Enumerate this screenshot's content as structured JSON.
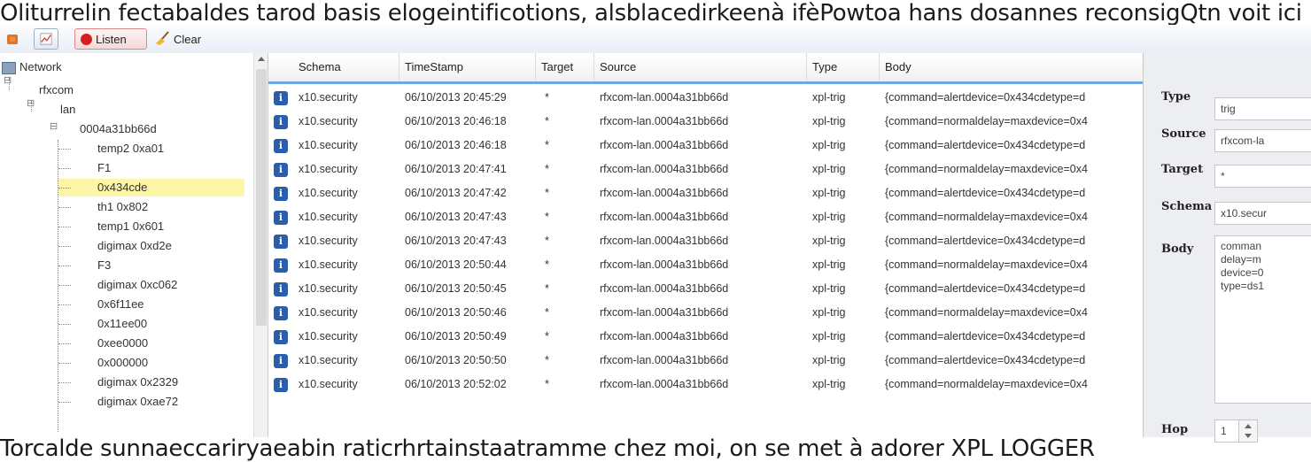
{
  "overlay": {
    "top_text": "Oliturrelin fectabaldes tarod basis elogeintificotions, alsblacedirkeenà ifèPowtoa hans dosannes reconsigQtn voit ici",
    "bottom_text": "Torcalde sunnaeccariryaeabin raticrhrtainstaatramme chez moi, on se met à adorer XPL LOGGER"
  },
  "toolbar": {
    "orange_icon": "home-icon",
    "chart_icon": "chart-icon",
    "listen_label": "Listen",
    "clear_label": "Clear",
    "clear_icon": "broom-icon"
  },
  "tree": {
    "root": "Network",
    "nodes": [
      {
        "label": "rfxcom"
      },
      {
        "label": "lan"
      },
      {
        "label": "0004a31bb66d"
      },
      {
        "label": "temp2 0xa01"
      },
      {
        "label": "F1"
      },
      {
        "label": "0x434cde",
        "selected": true
      },
      {
        "label": "th1 0x802"
      },
      {
        "label": "temp1 0x601"
      },
      {
        "label": "digimax 0xd2e"
      },
      {
        "label": "F3"
      },
      {
        "label": "digimax 0xc062"
      },
      {
        "label": "0x6f11ee"
      },
      {
        "label": "0x11ee00"
      },
      {
        "label": "0xee0000"
      },
      {
        "label": "0x000000"
      },
      {
        "label": "digimax 0x2329"
      },
      {
        "label": "digimax 0xae72"
      }
    ]
  },
  "grid": {
    "columns": [
      "Schema",
      "TimeStamp",
      "Target",
      "Source",
      "Type",
      "Body"
    ],
    "rows": [
      {
        "schema": "x10.security",
        "timestamp": "06/10/2013 20:45:29",
        "target": "*",
        "source": "rfxcom-lan.0004a31bb66d",
        "type": "xpl-trig",
        "body": "{command=alertdevice=0x434cdetype=d"
      },
      {
        "schema": "x10.security",
        "timestamp": "06/10/2013 20:46:18",
        "target": "*",
        "source": "rfxcom-lan.0004a31bb66d",
        "type": "xpl-trig",
        "body": "{command=normaldelay=maxdevice=0x4"
      },
      {
        "schema": "x10.security",
        "timestamp": "06/10/2013 20:46:18",
        "target": "*",
        "source": "rfxcom-lan.0004a31bb66d",
        "type": "xpl-trig",
        "body": "{command=alertdevice=0x434cdetype=d"
      },
      {
        "schema": "x10.security",
        "timestamp": "06/10/2013 20:47:41",
        "target": "*",
        "source": "rfxcom-lan.0004a31bb66d",
        "type": "xpl-trig",
        "body": "{command=normaldelay=maxdevice=0x4"
      },
      {
        "schema": "x10.security",
        "timestamp": "06/10/2013 20:47:42",
        "target": "*",
        "source": "rfxcom-lan.0004a31bb66d",
        "type": "xpl-trig",
        "body": "{command=alertdevice=0x434cdetype=d"
      },
      {
        "schema": "x10.security",
        "timestamp": "06/10/2013 20:47:43",
        "target": "*",
        "source": "rfxcom-lan.0004a31bb66d",
        "type": "xpl-trig",
        "body": "{command=normaldelay=maxdevice=0x4"
      },
      {
        "schema": "x10.security",
        "timestamp": "06/10/2013 20:47:43",
        "target": "*",
        "source": "rfxcom-lan.0004a31bb66d",
        "type": "xpl-trig",
        "body": "{command=alertdevice=0x434cdetype=d"
      },
      {
        "schema": "x10.security",
        "timestamp": "06/10/2013 20:50:44",
        "target": "*",
        "source": "rfxcom-lan.0004a31bb66d",
        "type": "xpl-trig",
        "body": "{command=normaldelay=maxdevice=0x4"
      },
      {
        "schema": "x10.security",
        "timestamp": "06/10/2013 20:50:45",
        "target": "*",
        "source": "rfxcom-lan.0004a31bb66d",
        "type": "xpl-trig",
        "body": "{command=alertdevice=0x434cdetype=d"
      },
      {
        "schema": "x10.security",
        "timestamp": "06/10/2013 20:50:46",
        "target": "*",
        "source": "rfxcom-lan.0004a31bb66d",
        "type": "xpl-trig",
        "body": "{command=normaldelay=maxdevice=0x4"
      },
      {
        "schema": "x10.security",
        "timestamp": "06/10/2013 20:50:49",
        "target": "*",
        "source": "rfxcom-lan.0004a31bb66d",
        "type": "xpl-trig",
        "body": "{command=alertdevice=0x434cdetype=d"
      },
      {
        "schema": "x10.security",
        "timestamp": "06/10/2013 20:50:50",
        "target": "*",
        "source": "rfxcom-lan.0004a31bb66d",
        "type": "xpl-trig",
        "body": "{command=alertdevice=0x434cdetype=d"
      },
      {
        "schema": "x10.security",
        "timestamp": "06/10/2013 20:52:02",
        "target": "*",
        "source": "rfxcom-lan.0004a31bb66d",
        "type": "xpl-trig",
        "body": "{command=normaldelay=maxdevice=0x4"
      }
    ]
  },
  "properties": {
    "type_label": "Type",
    "type_value": "trig",
    "source_label": "Source",
    "source_value": "rfxcom-la",
    "target_label": "Target",
    "target_value": "*",
    "schema_label": "Schema",
    "schema_value": "x10.secur",
    "body_label": "Body",
    "body_value": "comman\ndelay=m\ndevice=0\ntype=ds1",
    "hop_label": "Hop",
    "hop_value": "1"
  }
}
